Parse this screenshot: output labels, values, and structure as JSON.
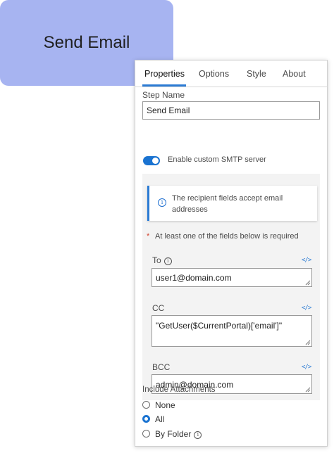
{
  "node": {
    "title": "Send Email"
  },
  "tabs": [
    {
      "label": "Properties",
      "active": true
    },
    {
      "label": "Options",
      "active": false
    },
    {
      "label": "Style",
      "active": false
    },
    {
      "label": "About",
      "active": false
    }
  ],
  "step_name": {
    "label": "Step Name",
    "value": "Send Email"
  },
  "smtp_toggle": {
    "label": "Enable custom SMTP server",
    "on": true
  },
  "notice": {
    "text": "The recipient fields accept email addresses"
  },
  "requirement": {
    "star": "*",
    "text": "At least one of the fields below is required"
  },
  "fields": {
    "to": {
      "label": "To",
      "value": "user1@domain.com"
    },
    "cc": {
      "label": "CC",
      "value": "\"GetUser($CurrentPortal)['email']\""
    },
    "bcc": {
      "label": "BCC",
      "value": "admin@domain.com"
    }
  },
  "attachments": {
    "label": "Include Attachments",
    "options": [
      {
        "label": "None",
        "selected": false
      },
      {
        "label": "All",
        "selected": true
      },
      {
        "label": "By Folder",
        "selected": false
      }
    ]
  },
  "icons": {
    "code": "code-icon",
    "info": "info-icon"
  },
  "colors": {
    "accent": "#2b7bd4",
    "node_fill": "#a7b4f1"
  }
}
